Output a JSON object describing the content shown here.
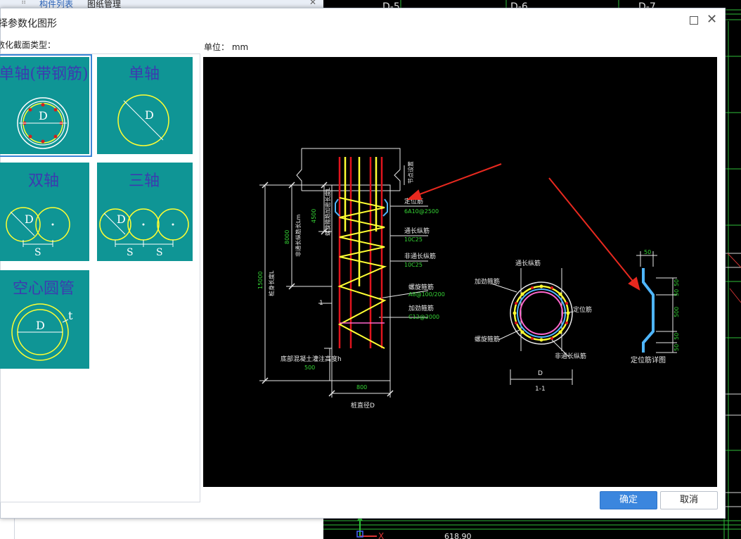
{
  "background": {
    "tabs": [
      "构件列表",
      "图纸管理"
    ],
    "cad": {
      "axis_labels": [
        "D-5",
        "D-6",
        "D-7"
      ],
      "bottom_value": "618.90"
    }
  },
  "dialog": {
    "title": "择参数化图形",
    "section_label": "数化截面类型：",
    "unit_label": "单位： mm",
    "types": [
      {
        "label": "单轴(带钢筋)",
        "selected": true
      },
      {
        "label": "单轴",
        "selected": false
      },
      {
        "label": "双轴",
        "selected": false
      },
      {
        "label": "三轴",
        "selected": false
      },
      {
        "label": "空心圆管",
        "selected": false
      }
    ],
    "glyph": {
      "d": "D",
      "s": "S",
      "t": "t"
    },
    "ok_label": "确定",
    "cancel_label": "取消"
  },
  "drawing": {
    "dims": {
      "total_length": "15000",
      "non_through_length": "8000",
      "spiral_dense_length": "4500",
      "bottom_height": "500",
      "pile_width": "800"
    },
    "labels": {
      "total_length_label": "桩身长度L",
      "non_through_label": "非通长纵筋长Lm",
      "dense_label": "螺旋箍筋加密长度L",
      "top_label": "节点设置",
      "positioning_bar": "定位筋",
      "positioning_spec": "6A10@2500",
      "through_bar": "通长纵筋",
      "through_spec": "10C25",
      "non_through_bar": "非通长纵筋",
      "non_through_spec": "10C25",
      "spiral_bar": "螺旋箍筋",
      "spiral_spec": "A8@100/200",
      "stiff_bar": "加劲箍筋",
      "stiff_spec": "C12@2000",
      "bottom_label": "底部混凝土灌注高度h",
      "pile_dia_label": "桩直径D",
      "section_mark": "1",
      "sec_through": "通长纵筋",
      "sec_stiff": "加劲箍筋",
      "sec_positioning": "定位筋",
      "sec_spiral": "螺旋箍筋",
      "sec_non_through": "非通长纵筋",
      "sec_d": "D",
      "sec_name": "1-1",
      "detail_dim_top": "50",
      "detail_dim_a": "50",
      "detail_dim_b": "50",
      "detail_dim_mid": "500",
      "detail_dim_c": "50",
      "detail_dim_d": "50",
      "detail_name": "定位筋详图"
    }
  }
}
